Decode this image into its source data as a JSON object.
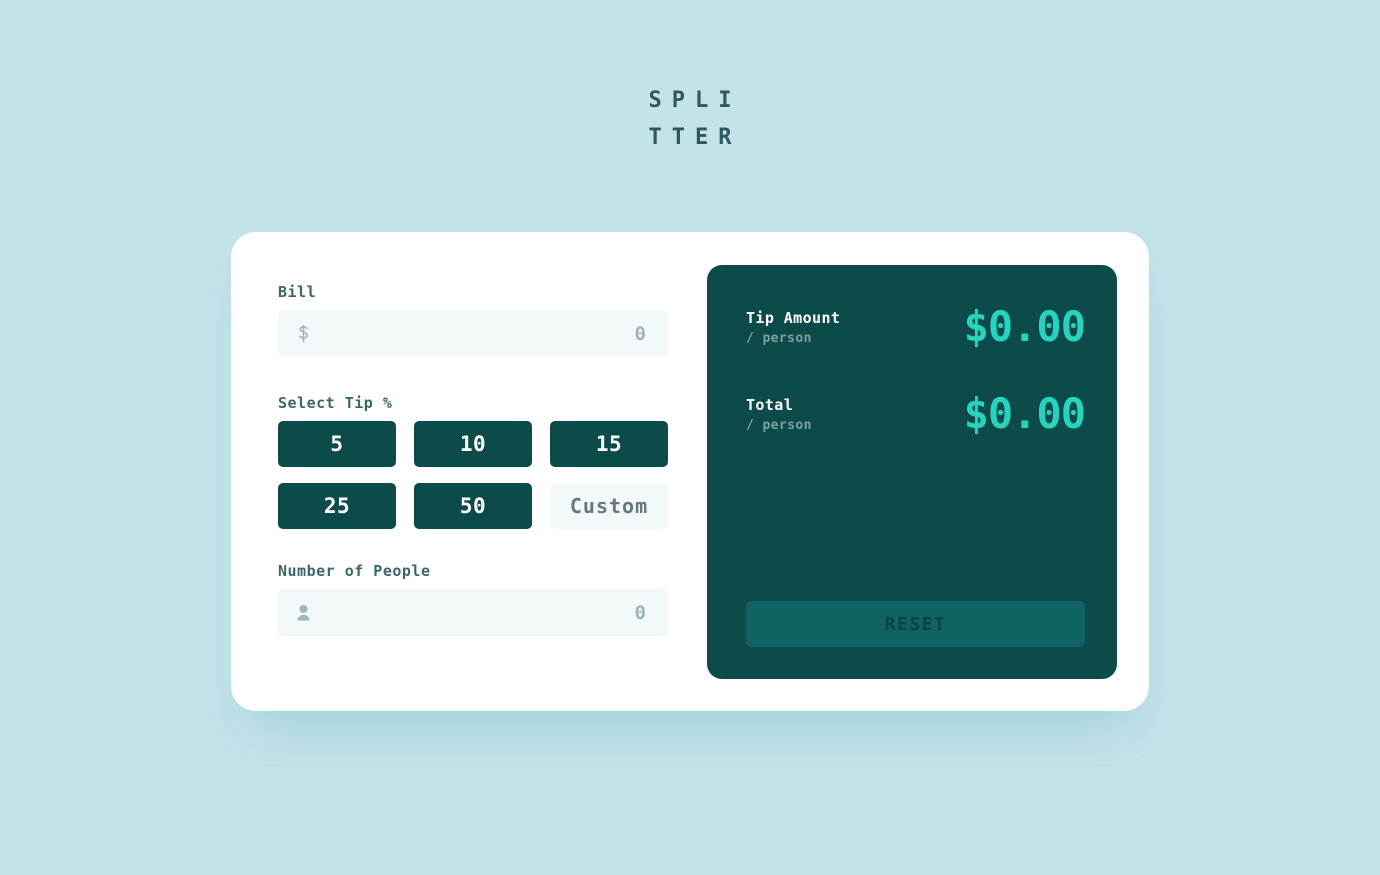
{
  "app": {
    "logo_line1": "SPLI",
    "logo_line2": "TTER"
  },
  "form": {
    "bill": {
      "label": "Bill",
      "icon": "dollar-icon",
      "icon_glyph": "$",
      "value": "0",
      "placeholder": "0"
    },
    "tip": {
      "label": "Select Tip %",
      "options": [
        {
          "label": "5",
          "selected": false
        },
        {
          "label": "10",
          "selected": false
        },
        {
          "label": "15",
          "selected": false
        },
        {
          "label": "25",
          "selected": false
        },
        {
          "label": "50",
          "selected": false
        }
      ],
      "custom_label": "Custom",
      "custom_placeholder": "Custom"
    },
    "people": {
      "label": "Number of People",
      "icon": "person-icon",
      "value": "0",
      "placeholder": "0"
    }
  },
  "results": {
    "tip": {
      "label": "Tip Amount",
      "sublabel": "/ person",
      "amount": "$0.00"
    },
    "total": {
      "label": "Total",
      "sublabel": "/ person",
      "amount": "$0.00"
    },
    "reset_label": "RESET"
  },
  "colors": {
    "background": "#c2e2e8",
    "card": "#ffffff",
    "panel_dark": "#0d4b4b",
    "accent_mint": "#27d3bd",
    "input_bg": "#f3f8fb",
    "reset_bg": "#0f6363",
    "muted_text": "#9db4b6"
  }
}
